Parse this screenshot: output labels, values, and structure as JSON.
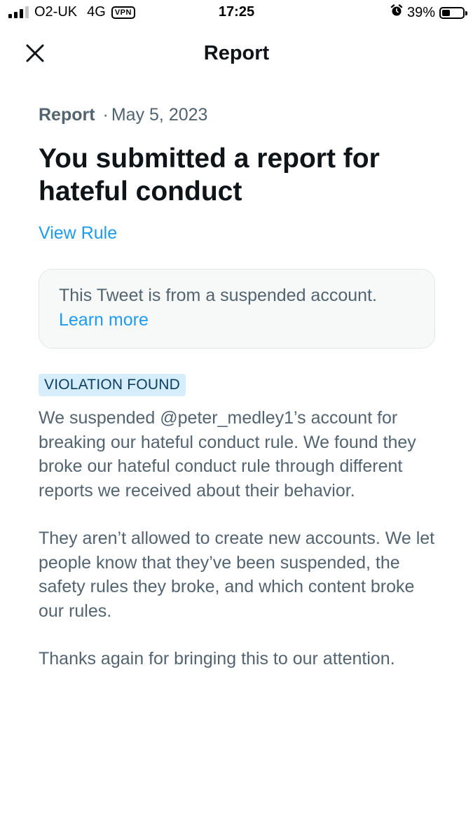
{
  "status_bar": {
    "carrier": "O2-UK",
    "network": "4G",
    "vpn": "VPN",
    "time": "17:25",
    "battery_percent": "39%",
    "alarm_icon": "alarm-icon",
    "battery_level": 0.39
  },
  "header": {
    "title": "Report",
    "close_icon": "close-icon"
  },
  "report": {
    "label": "Report",
    "separator": "·",
    "date": "May 5, 2023",
    "headline": "You submitted a report for hateful conduct",
    "view_rule": "View Rule"
  },
  "notice": {
    "text": "This Tweet is from a suspended account.",
    "link": "Learn more"
  },
  "badge": "VIOLATION FOUND",
  "paragraphs": [
    "We suspended @peter_medley1’s account for breaking our hateful conduct rule. We found they broke our hateful conduct rule through different reports we received about their behavior.",
    "They aren’t allowed to create new accounts. We let people know that they’ve been suspended, the safety rules they broke, and which content broke our rules.",
    "Thanks again for bringing this to our attention."
  ],
  "colors": {
    "accent": "#1d9bf0",
    "secondary_text": "#536471",
    "badge_bg": "#d6eefc"
  }
}
